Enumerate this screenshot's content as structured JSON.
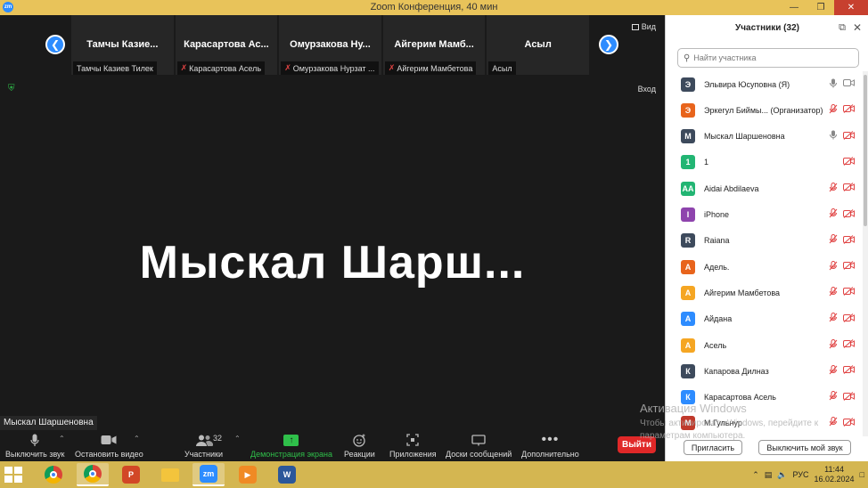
{
  "window": {
    "title": "Zoom Конференция, 40 мин",
    "logo": "zm"
  },
  "meeting": {
    "view_label": "Вид",
    "enter_label": "Вход",
    "active_speaker": "Мыскал  Шарш...",
    "speaker_tag": "Мыскал Шаршеновна",
    "tiles": [
      {
        "display": "Тамчы      Казие...",
        "label": "Тамчы      Казиев Тилек",
        "muted": false
      },
      {
        "display": "Карасартова  Ас...",
        "label": "Карасартова Асель",
        "muted": true
      },
      {
        "display": "Омурзакова  Ну...",
        "label": "Омурзакова Нурзат ...",
        "muted": true
      },
      {
        "display": "Айгерим  Мамб...",
        "label": "Айгерим Мамбетова",
        "muted": true
      },
      {
        "display": "Асыл",
        "label": "Асыл",
        "muted": false
      }
    ]
  },
  "toolbar": {
    "mute": "Выключить звук",
    "video": "Остановить видео",
    "participants": "Участники",
    "participants_count": "32",
    "share": "Демонстрация экрана",
    "reactions": "Реакции",
    "apps": "Приложения",
    "whiteboards": "Доски сообщений",
    "more": "Дополнительно",
    "leave": "Выйти"
  },
  "panel": {
    "title": "Участники (32)",
    "search_placeholder": "Найти участника",
    "invite": "Пригласить",
    "unmute_me": "Выключить мой звук",
    "participants": [
      {
        "initials": "Э",
        "name": "Эльвира Юсуповна (Я)",
        "color": "#3d4a5c",
        "mic": "on",
        "cam": "on"
      },
      {
        "initials": "Э",
        "name": "Эркегул Биймы... (Организатор)",
        "color": "#e8641c",
        "mic": "off",
        "cam": "off"
      },
      {
        "initials": "М",
        "name": "Мыскал Шаршеновна",
        "color": "#3d4a5c",
        "mic": "on",
        "cam": "off"
      },
      {
        "initials": "1",
        "name": "1",
        "color": "#22b573",
        "mic": "none",
        "cam": "off"
      },
      {
        "initials": "AA",
        "name": "Aidai Abdilaeva",
        "color": "#22b573",
        "mic": "off",
        "cam": "off"
      },
      {
        "initials": "I",
        "name": "iPhone",
        "color": "#8e44ad",
        "mic": "off",
        "cam": "off"
      },
      {
        "initials": "R",
        "name": "Raiana",
        "color": "#3d4a5c",
        "mic": "off",
        "cam": "off"
      },
      {
        "initials": "А",
        "name": "Адель.",
        "color": "#e8641c",
        "mic": "off",
        "cam": "off"
      },
      {
        "initials": "А",
        "name": "Айгерим Мамбетова",
        "color": "#f5a623",
        "mic": "off",
        "cam": "off"
      },
      {
        "initials": "А",
        "name": "Айдана",
        "color": "#2d8cff",
        "mic": "off",
        "cam": "off"
      },
      {
        "initials": "А",
        "name": "Асель",
        "color": "#f5a623",
        "mic": "off",
        "cam": "off"
      },
      {
        "initials": "К",
        "name": "Капарова Дилназ",
        "color": "#3d4a5c",
        "mic": "off",
        "cam": "off"
      },
      {
        "initials": "К",
        "name": "Карасартова Асель",
        "color": "#2d8cff",
        "mic": "off",
        "cam": "off"
      },
      {
        "initials": "М",
        "name": "М.Гульнур",
        "color": "#c0392b",
        "mic": "off",
        "cam": "off"
      }
    ]
  },
  "watermark": {
    "line1": "Активация Windows",
    "line2": "Чтобы активировать Windows, перейдите к",
    "line3": "параметрам компьютера."
  },
  "taskbar": {
    "lang": "РУС",
    "time": "11:44",
    "date": "16.02.2024",
    "apps": [
      {
        "name": "chrome",
        "label": "",
        "color": "#db4437"
      },
      {
        "name": "chrome-2",
        "label": "",
        "color": "#db4437"
      },
      {
        "name": "powerpoint",
        "label": "P",
        "color": "#d24726"
      },
      {
        "name": "file-explorer",
        "label": "",
        "color": "#f3c43c"
      },
      {
        "name": "zoom",
        "label": "zm",
        "color": "#2d8cff"
      },
      {
        "name": "media-player",
        "label": "▶",
        "color": "#f08a24"
      },
      {
        "name": "word",
        "label": "W",
        "color": "#2b579a"
      }
    ]
  }
}
